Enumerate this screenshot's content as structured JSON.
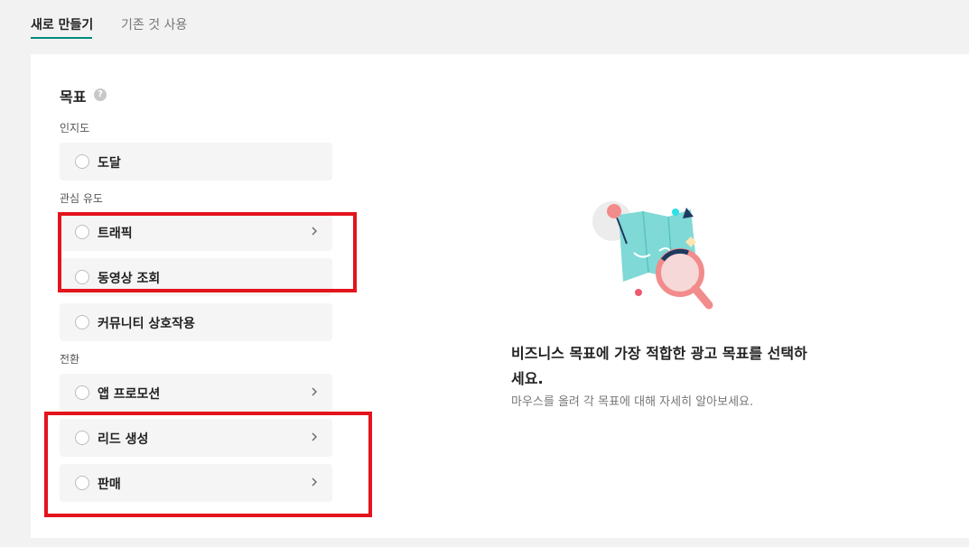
{
  "tabs": {
    "new": "새로 만들기",
    "existing": "기존 것 사용"
  },
  "objective": {
    "title": "목표",
    "help_icon": "?",
    "groups": [
      {
        "label": "인지도",
        "options": [
          {
            "label": "도달",
            "has_chevron": false
          }
        ]
      },
      {
        "label": "관심 유도",
        "options": [
          {
            "label": "트래픽",
            "has_chevron": true
          },
          {
            "label": "동영상 조회",
            "has_chevron": false
          },
          {
            "label": "커뮤니티 상호작용",
            "has_chevron": false
          }
        ]
      },
      {
        "label": "전환",
        "options": [
          {
            "label": "앱 프로모션",
            "has_chevron": true
          },
          {
            "label": "리드 생성",
            "has_chevron": true
          },
          {
            "label": "판매",
            "has_chevron": true
          }
        ]
      }
    ]
  },
  "info": {
    "title": "비즈니스 목표에 가장 적합한 광고 목표를 선택하세요.",
    "subtitle": "마우스를 올려 각 목표에 대해 자세히 알아보세요."
  },
  "colors": {
    "accent": "#00897b",
    "highlight": "#e3141c",
    "option_bg": "#f5f5f5"
  },
  "icons": {
    "help": "question-circle-icon",
    "chevron": "chevron-right-icon",
    "illustration": "map-magnifier-illustration"
  }
}
